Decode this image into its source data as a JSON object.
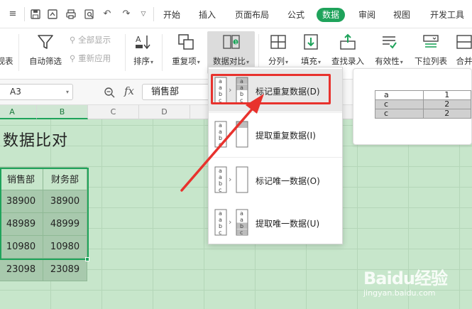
{
  "toolbar_tabs": [
    "开始",
    "插入",
    "页面布局",
    "公式",
    "数据",
    "审阅",
    "视图",
    "开发工具"
  ],
  "active_tab": "数据",
  "ribbon": {
    "partial_left": "视表",
    "auto_filter": "自动筛选",
    "show_all": "全部显示",
    "reapply": "重新应用",
    "sort": "排序",
    "duplicates": "重复项",
    "data_compare": "数据对比",
    "split_column": "分列",
    "fill": "填充",
    "lookup_entry": "查找录入",
    "validity": "有效性",
    "dropdown_list": "下拉列表",
    "partial_right": "合并"
  },
  "formula_bar": {
    "cell_ref": "A3",
    "fx": "fx",
    "content": "销售部"
  },
  "columns": [
    "A",
    "B",
    "C",
    "D"
  ],
  "sheet": {
    "title": "数据比对",
    "headers": [
      "销售部",
      "财务部"
    ],
    "rows": [
      [
        "38900",
        "38900"
      ],
      [
        "48989",
        "48999"
      ],
      [
        "10980",
        "10980"
      ],
      [
        "23098",
        "23089"
      ]
    ]
  },
  "dropdown_menu": [
    {
      "label": "标记重复数据(D)",
      "icon": "mark-duplicates-icon"
    },
    {
      "label": "提取重复数据(I)",
      "icon": "extract-duplicates-icon"
    },
    {
      "label": "标记唯一数据(O)",
      "icon": "mark-unique-icon"
    },
    {
      "label": "提取唯一数据(U)",
      "icon": "extract-unique-icon"
    }
  ],
  "menu_icon_letters": [
    "a",
    "a",
    "b",
    "c"
  ],
  "preview_table": [
    [
      "a",
      "1"
    ],
    [
      "c",
      "2"
    ],
    [
      "c",
      "2"
    ]
  ],
  "colors": {
    "accent": "#1fa35b",
    "annotation": "#e8322d",
    "sheet_bg": "#c7e6cb"
  },
  "watermark": {
    "brand": "Baidu经验",
    "url": "jingyan.baidu.com"
  }
}
